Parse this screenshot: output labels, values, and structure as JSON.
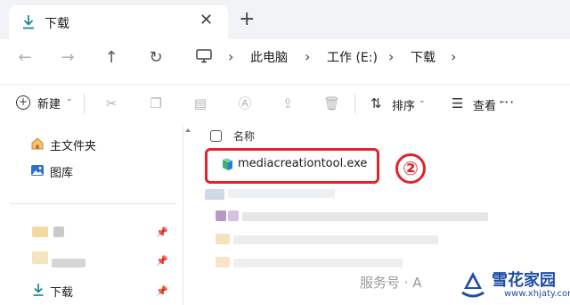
{
  "window": {
    "tab_title": "下载",
    "close_glyph": "✕",
    "new_tab_glyph": "+"
  },
  "address": {
    "back_glyph": "←",
    "forward_glyph": "→",
    "up_glyph": "↑",
    "refresh_glyph": "↻",
    "separator": "›",
    "crumbs": [
      "此电脑",
      "工作 (E:)",
      "下载"
    ]
  },
  "toolbar": {
    "new_label": "新建",
    "sort_label": "排序",
    "view_label": "查看",
    "more_glyph": "···",
    "chevron": "⌄"
  },
  "sidebar": {
    "items": [
      {
        "label": "主文件夹",
        "icon": "home-icon"
      },
      {
        "label": "图库",
        "icon": "gallery-icon"
      },
      {
        "label": "下载",
        "icon": "download-icon",
        "pinned": true
      }
    ]
  },
  "content": {
    "column_name": "名称",
    "files": [
      {
        "name": "mediacreationtool.exe",
        "icon": "installer-icon",
        "highlighted": true
      }
    ],
    "annotation": "②",
    "accent_color": "#e0242b"
  },
  "watermark": {
    "text": "服务号 · A",
    "logo_title": "雪花家园",
    "logo_url": "www.xhjaty.com"
  }
}
